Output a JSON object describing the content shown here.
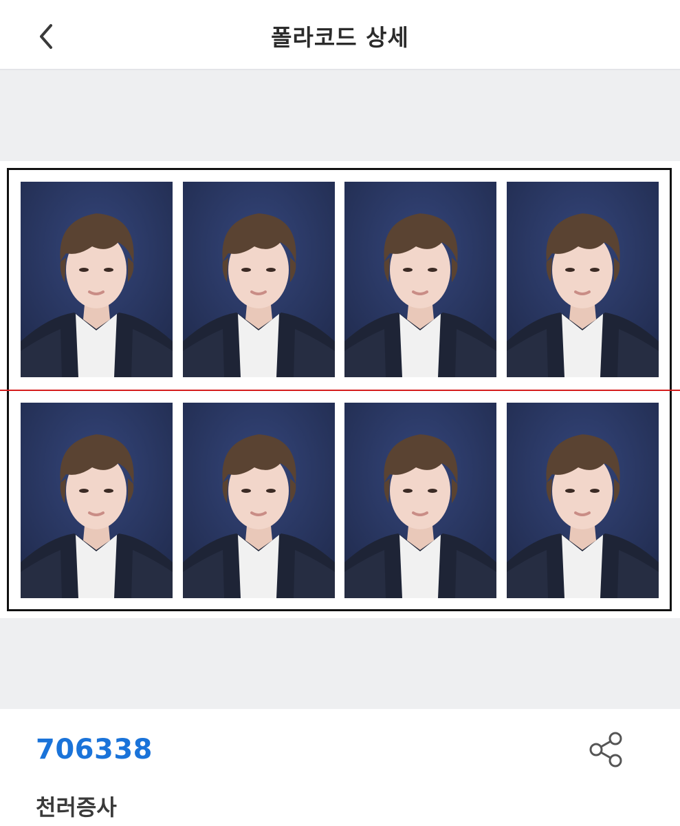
{
  "header": {
    "title": "폴라코드 상세",
    "back_icon": "chevron-left-icon"
  },
  "sheet": {
    "rows": 2,
    "columns": 4,
    "photo_count": 8,
    "background_color": "#243158",
    "cut_line_color": "#d51c1c"
  },
  "detail": {
    "code": "706338",
    "code_color": "#1a73d9",
    "name": "천러증사",
    "share_icon": "share-icon"
  }
}
